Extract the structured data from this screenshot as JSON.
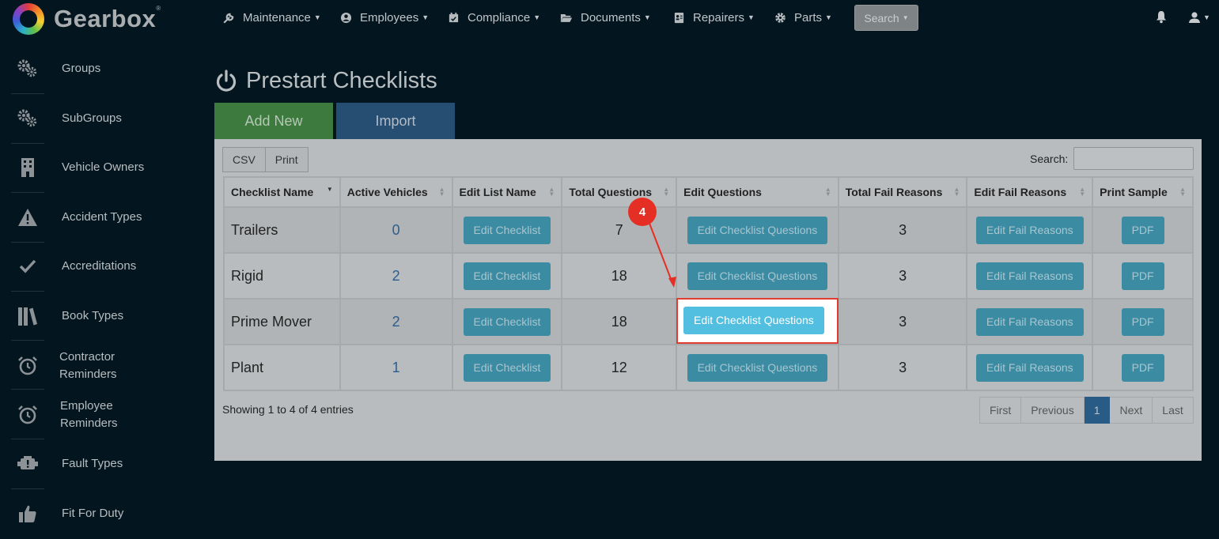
{
  "app": {
    "name": "Gearbox",
    "trademark": "®"
  },
  "nav": {
    "items": [
      {
        "label": "Maintenance",
        "icon": "wrench-icon"
      },
      {
        "label": "Employees",
        "icon": "user-circle-icon"
      },
      {
        "label": "Compliance",
        "icon": "calendar-icon"
      },
      {
        "label": "Documents",
        "icon": "folder-open-icon"
      },
      {
        "label": "Repairers",
        "icon": "address-card-icon"
      },
      {
        "label": "Parts",
        "icon": "gear-icon"
      }
    ],
    "search_label": "Search"
  },
  "sidebar": {
    "items": [
      {
        "label": "Groups",
        "icon": "gears-icon"
      },
      {
        "label": "SubGroups",
        "icon": "gears-icon"
      },
      {
        "label": "Vehicle Owners",
        "icon": "building-icon"
      },
      {
        "label": "Accident Types",
        "icon": "warning-icon"
      },
      {
        "label": "Accreditations",
        "icon": "check-icon"
      },
      {
        "label": "Book Types",
        "icon": "books-icon"
      },
      {
        "label": "Contractor Reminders",
        "icon": "alarm-clock-icon"
      },
      {
        "label": "Employee Reminders",
        "icon": "alarm-clock-icon"
      },
      {
        "label": "Fault Types",
        "icon": "engine-warning-icon"
      },
      {
        "label": "Fit For Duty",
        "icon": "thumbs-up-icon"
      }
    ]
  },
  "page": {
    "title": "Prestart Checklists",
    "add_new": "Add New",
    "import": "Import"
  },
  "table": {
    "export_buttons": [
      "CSV",
      "Print"
    ],
    "search_label": "Search:",
    "columns": [
      "Checklist Name",
      "Active Vehicles",
      "Edit List Name",
      "Total Questions",
      "Edit Questions",
      "Total Fail Reasons",
      "Edit Fail Reasons",
      "Print Sample"
    ],
    "rows": [
      {
        "name": "Trailers",
        "active_vehicles": "0",
        "edit_list": "Edit Checklist",
        "total_questions": "7",
        "edit_questions": "Edit Checklist Questions",
        "total_fail_reasons": "3",
        "edit_fail": "Edit Fail Reasons",
        "print": "PDF"
      },
      {
        "name": "Rigid",
        "active_vehicles": "2",
        "edit_list": "Edit Checklist",
        "total_questions": "18",
        "edit_questions": "Edit Checklist Questions",
        "total_fail_reasons": "3",
        "edit_fail": "Edit Fail Reasons",
        "print": "PDF"
      },
      {
        "name": "Prime Mover",
        "active_vehicles": "2",
        "edit_list": "Edit Checklist",
        "total_questions": "18",
        "edit_questions": "Edit Checklist Questions",
        "total_fail_reasons": "3",
        "edit_fail": "Edit Fail Reasons",
        "print": "PDF"
      },
      {
        "name": "Plant",
        "active_vehicles": "1",
        "edit_list": "Edit Checklist",
        "total_questions": "12",
        "edit_questions": "Edit Checklist Questions",
        "total_fail_reasons": "3",
        "edit_fail": "Edit Fail Reasons",
        "print": "PDF"
      }
    ],
    "info": "Showing 1 to 4 of 4 entries",
    "pagination": [
      "First",
      "Previous",
      "1",
      "Next",
      "Last"
    ],
    "active_page": "1"
  },
  "annotation": {
    "step": "4",
    "color": "#e52e24"
  }
}
